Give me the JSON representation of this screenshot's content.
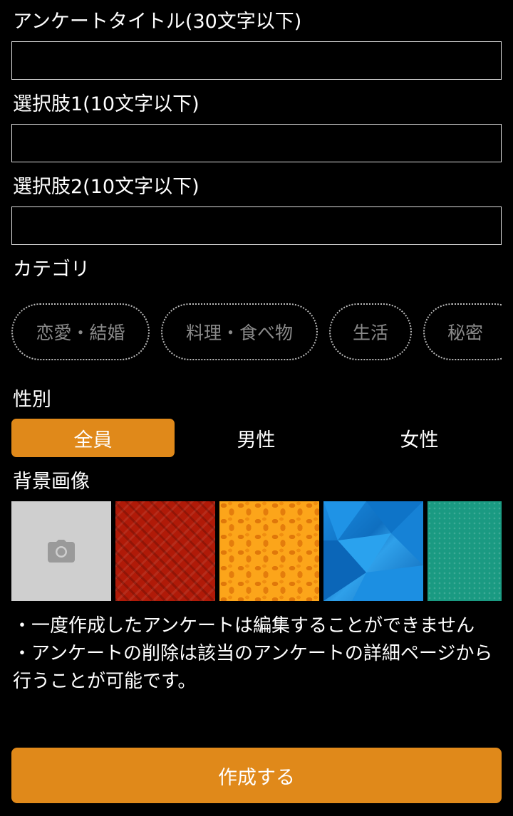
{
  "form": {
    "title_label": "アンケートタイトル(30文字以下)",
    "title_value": "",
    "choice1_label": "選択肢1(10文字以下)",
    "choice1_value": "",
    "choice2_label": "選択肢2(10文字以下)",
    "choice2_value": ""
  },
  "category": {
    "label": "カテゴリ",
    "items": [
      "恋愛・結婚",
      "料理・食べ物",
      "生活",
      "秘密"
    ]
  },
  "gender": {
    "label": "性別",
    "options": [
      "全員",
      "男性",
      "女性"
    ],
    "selected": "全員"
  },
  "background": {
    "label": "背景画像",
    "tiles": [
      {
        "name": "camera-icon",
        "color": "#cfcfcf"
      },
      {
        "name": "red-plaid",
        "color": "#b01a08"
      },
      {
        "name": "orange-leopard",
        "color": "#fca51a"
      },
      {
        "name": "blue-polygon",
        "color": "#1a8be0"
      },
      {
        "name": "teal-dots",
        "color": "#1a9a82"
      }
    ]
  },
  "notes": {
    "line1": "・一度作成したアンケートは編集することができません",
    "line2": "・アンケートの削除は該当のアンケートの詳細ページから行うことが可能です。"
  },
  "submit_label": "作成する",
  "colors": {
    "accent": "#e0891a",
    "background": "#000000",
    "chip_text": "#8a8a8a"
  }
}
